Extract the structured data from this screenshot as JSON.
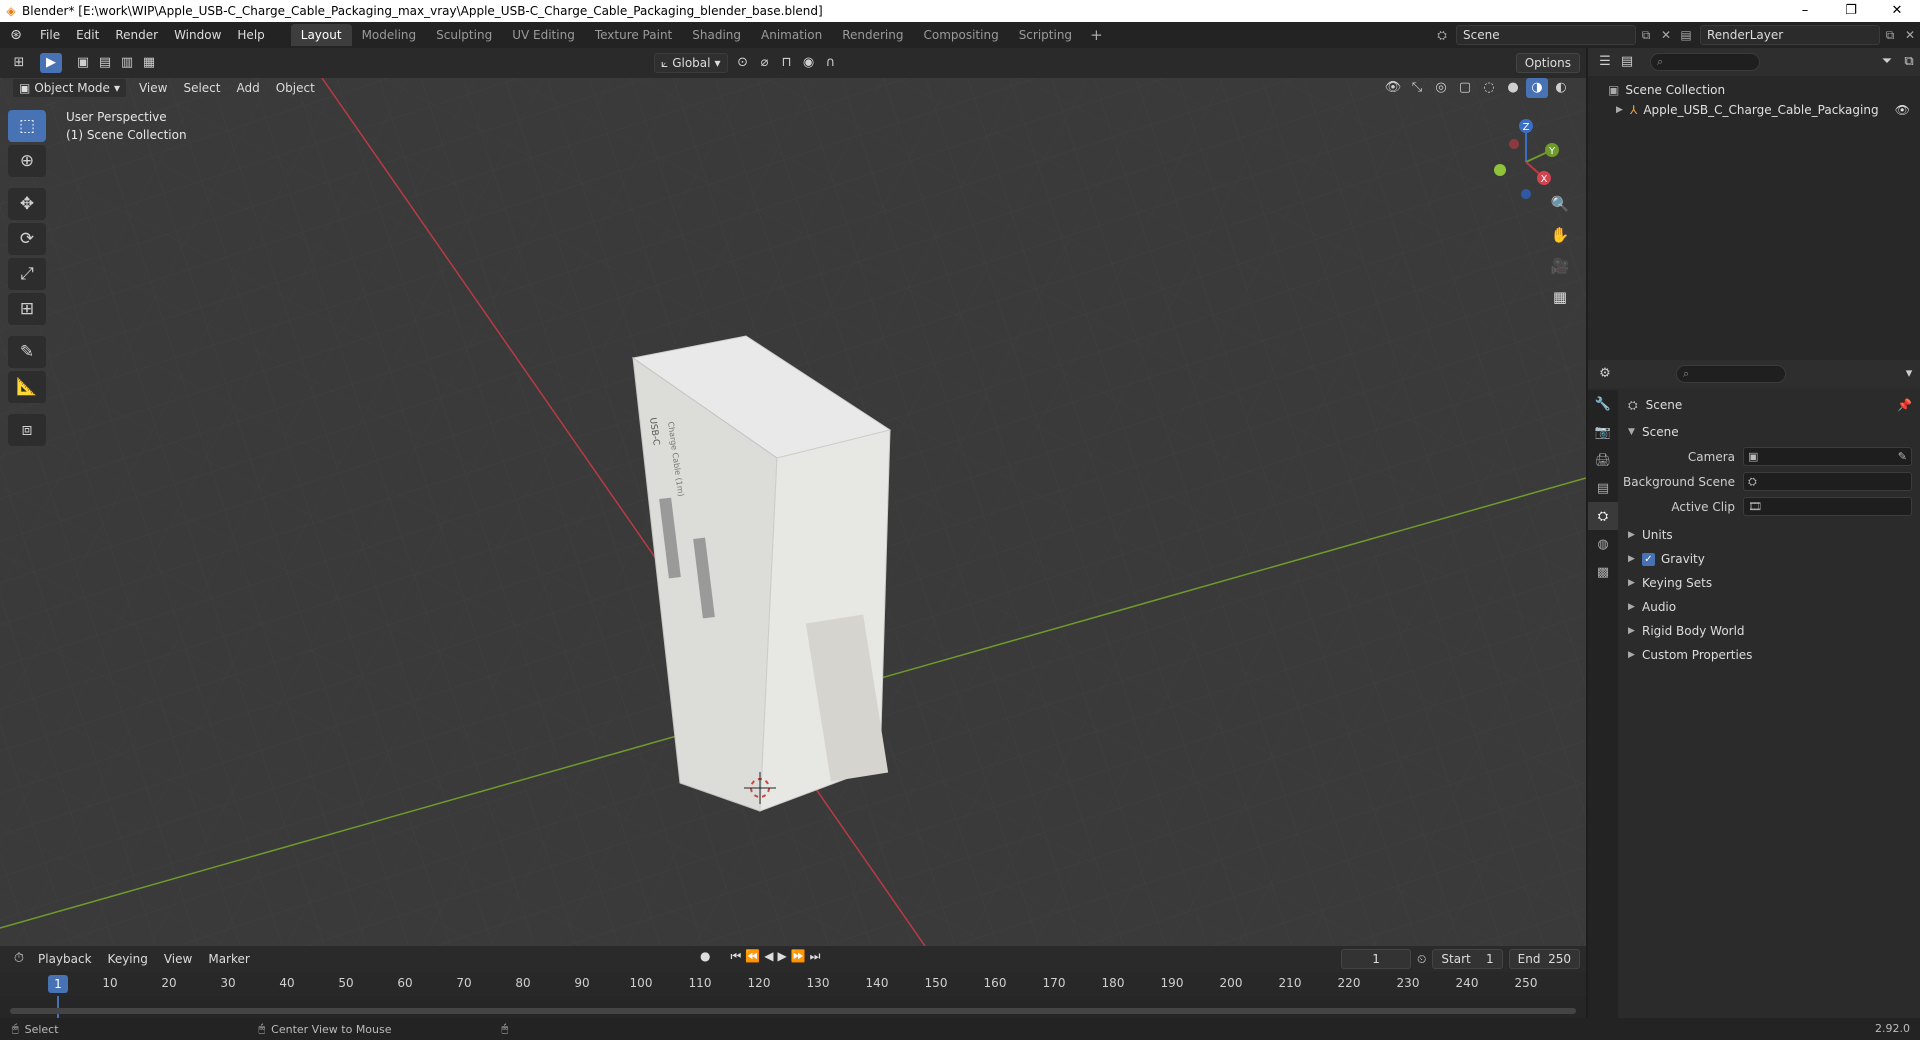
{
  "window": {
    "title": "Blender* [E:\\work\\WIP\\Apple_USB-C_Charge_Cable_Packaging_max_vray\\Apple_USB-C_Charge_Cable_Packaging_blender_base.blend]",
    "minimize": "–",
    "maximize": "❐",
    "close": "✕"
  },
  "menu": [
    "File",
    "Edit",
    "Render",
    "Window",
    "Help"
  ],
  "workspaces": [
    "Layout",
    "Modeling",
    "Sculpting",
    "UV Editing",
    "Texture Paint",
    "Shading",
    "Animation",
    "Rendering",
    "Compositing",
    "Scripting"
  ],
  "workspace_add": "+",
  "top_right": {
    "scene": "Scene",
    "render_layer": "RenderLayer"
  },
  "viewport_header": {
    "transform_orientation": "Global",
    "options": "Options"
  },
  "viewport_menu": {
    "mode": "Object Mode",
    "items": [
      "View",
      "Select",
      "Add",
      "Object"
    ]
  },
  "viewport_info": {
    "perspective": "User Perspective",
    "collection": "(1) Scene Collection"
  },
  "gizmo": {
    "x": "X",
    "y": "Y",
    "z": "Z"
  },
  "outliner": {
    "root": "Scene Collection",
    "child": "Apple_USB_C_Charge_Cable_Packaging"
  },
  "properties": {
    "title": "Scene",
    "section": "Scene",
    "fields": [
      {
        "label": "Camera"
      },
      {
        "label": "Background Scene"
      },
      {
        "label": "Active Clip"
      }
    ],
    "subsections": [
      "Units",
      "Gravity",
      "Keying Sets",
      "Audio",
      "Rigid Body World",
      "Custom Properties"
    ]
  },
  "timeline": {
    "menu": [
      "Playback",
      "Keying",
      "View",
      "Marker"
    ],
    "current_frame": "1",
    "start_label": "Start",
    "start": "1",
    "end_label": "End",
    "end": "250",
    "ticks": [
      "10",
      "20",
      "30",
      "40",
      "50",
      "60",
      "70",
      "80",
      "90",
      "100",
      "110",
      "120",
      "130",
      "140",
      "150",
      "160",
      "170",
      "180",
      "190",
      "200",
      "210",
      "220",
      "230",
      "240",
      "250"
    ]
  },
  "status": {
    "select": "Select",
    "center": "Center View to Mouse",
    "version": "2.92.0"
  },
  "box_label": {
    "brand": "USB-C",
    "subtitle": "Charge Cable (1m)"
  },
  "colors": {
    "accent": "#4772b3",
    "x_axis": "#b83a45",
    "y_axis": "#6f9a2c",
    "z_axis": "#3a6fc4"
  }
}
